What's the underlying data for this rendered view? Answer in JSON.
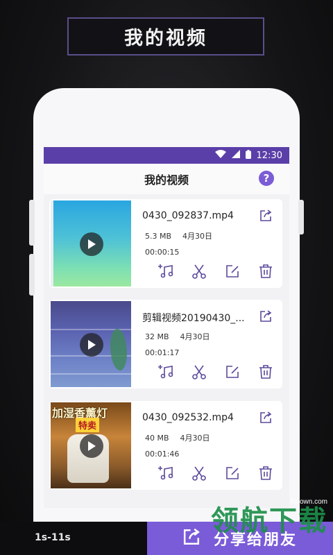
{
  "banner": {
    "title": "我的视频"
  },
  "status": {
    "time": "12:30"
  },
  "appbar": {
    "title": "我的视频",
    "help": "?"
  },
  "videos": [
    {
      "name": "0430_092837.mp4",
      "size": "5.3 MB",
      "date": "4月30日",
      "duration": "00:00:15"
    },
    {
      "name": "剪辑视频20190430_...",
      "size": "32 MB",
      "date": "4月30日",
      "duration": "00:01:17"
    },
    {
      "name": "0430_092532.mp4",
      "size": "40 MB",
      "date": "4月30日",
      "duration": "00:01:46"
    }
  ],
  "thumb3": {
    "text1": "加湿香薰灯",
    "text2": "特卖"
  },
  "bottom": {
    "duration_label": "1s-11s",
    "share_label": "分享给朋友"
  },
  "watermark": {
    "site": "lhdown.com",
    "text": "领航下载"
  },
  "colors": {
    "accent": "#7a5bd8",
    "statusbar": "#5b3fa8",
    "icon": "#5b4a9a"
  }
}
